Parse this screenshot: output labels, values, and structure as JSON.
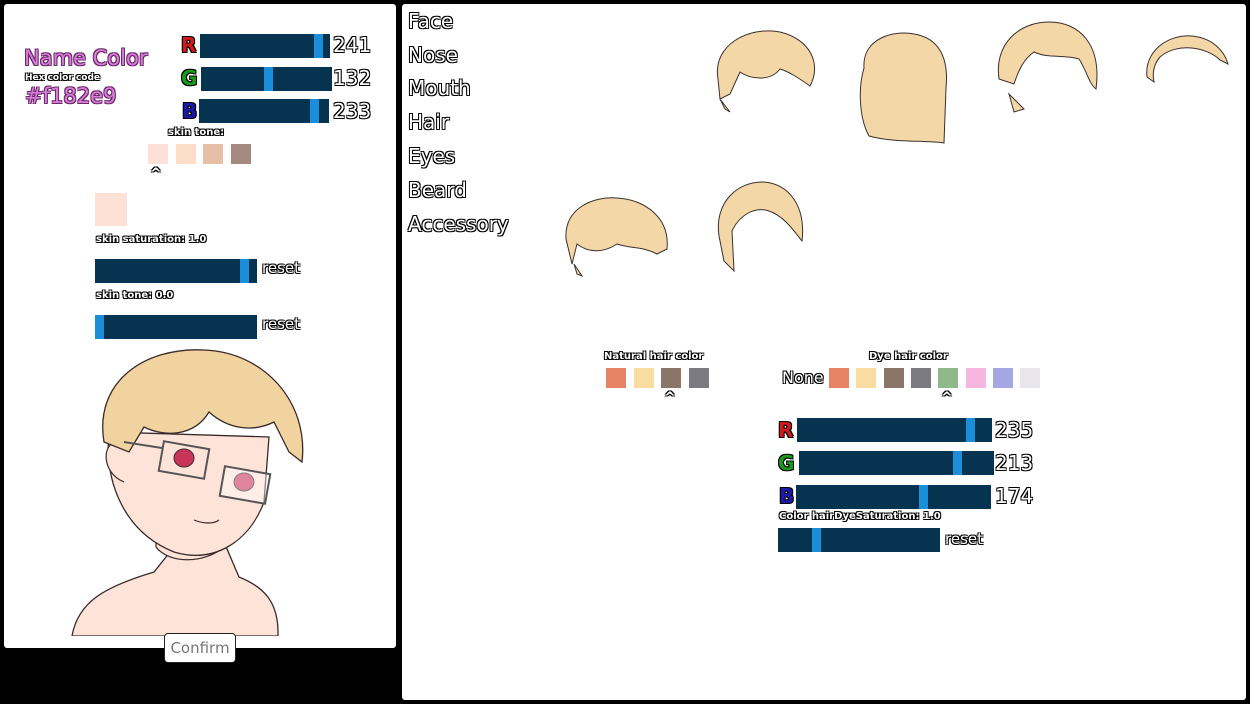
{
  "name_color": {
    "title": "Name Color",
    "hex_label": "Hex color code",
    "hex_value": "#f182e9",
    "color": "#f182e9",
    "r": {
      "label": "R",
      "value": "241",
      "fraction": 0.945
    },
    "g": {
      "label": "G",
      "value": "132",
      "fraction": 0.518
    },
    "b": {
      "label": "B",
      "value": "233",
      "fraction": 0.914
    }
  },
  "skin": {
    "tone_label": "skin tone:",
    "swatches": [
      "#fde1d8",
      "#fddec8",
      "#e6bfa7",
      "#a48a7e"
    ],
    "caret": "^",
    "preview_color": "#fde1d6",
    "saturation_label": "skin saturation: 1.0",
    "saturation_fraction": 0.95,
    "tone_value_label": "skin tone: 0.0",
    "tone_fraction": 0.0,
    "reset_label": "reset"
  },
  "confirm_label": "Confirm",
  "categories": [
    "Face",
    "Nose",
    "Mouth",
    "Hair",
    "Eyes",
    "Beard",
    "Accessory"
  ],
  "hair": {
    "natural_label": "Natural hair color",
    "natural_swatches": [
      "#e88466",
      "#f9dda0",
      "#8a7568",
      "#7a7a80"
    ],
    "dye_label": "Dye hair color",
    "dye_none": "None",
    "dye_swatches": [
      "#e88466",
      "#f9dda0",
      "#8a7568",
      "#7a7a80",
      "#8fb98a",
      "#f5b6e0",
      "#a5a6e4",
      "#e8e6ea"
    ],
    "caret": "^",
    "r": {
      "label": "R",
      "value": "235",
      "fraction": 0.91
    },
    "g": {
      "label": "G",
      "value": "213",
      "fraction": 0.83
    },
    "b": {
      "label": "B",
      "value": "174",
      "fraction": 0.66
    },
    "dye_saturation_label": "Color hairDyeSaturation: 1.0",
    "dye_saturation_fraction": 0.22,
    "reset_label": "reset",
    "hair_fill": "#f3d7a6"
  }
}
